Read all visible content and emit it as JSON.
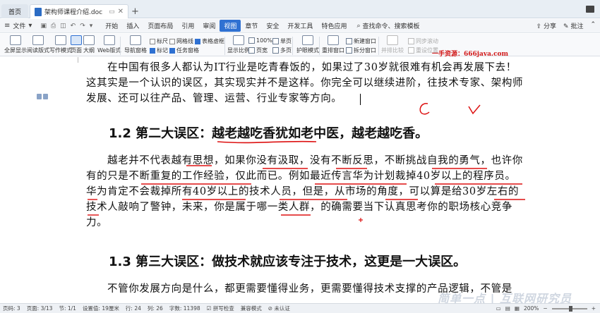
{
  "tabs": {
    "home": "首页",
    "doc": "架构师课程介绍.doc"
  },
  "menubar": {
    "file": "文件",
    "items": [
      "开始",
      "插入",
      "页面布局",
      "引用",
      "审阅",
      "视图",
      "章节",
      "安全",
      "开发工具",
      "特色应用"
    ],
    "active_index": 5,
    "search": "查找命令、搜索模板",
    "share": "分享",
    "comment": "批注"
  },
  "ribbon": {
    "full_screen": "全屏显示",
    "reading": "阅读版式",
    "writing": "写作模式",
    "page": "页面",
    "outline": "大纲",
    "web": "Web版式",
    "nav_pane": "导航窗格",
    "ruler": "标尺",
    "gridlines": "网格线",
    "table_gridlines": "表格虚框",
    "mark": "标记",
    "task_pane": "任务窗格",
    "display_ratio": "显示比例",
    "zoom_100": "100%",
    "single_page": "单页",
    "page_width": "页宽",
    "multi_page": "多页",
    "eye_mode": "护眼模式",
    "rearrange": "重排窗口",
    "new_window": "新建窗口",
    "split_window": "拆分窗口",
    "side_by_side": "并排比较",
    "sync_scroll": "同步滚动",
    "reset_pos": "重设位置"
  },
  "watermark": {
    "source": "一手资源：666java.com",
    "brand": "简单一点 | 互联网研究员"
  },
  "document": {
    "para1": "在中国有很多人都认为IT行业是吃青春饭的，如果过了30岁就很难有机会再发展下去！这其实是一个认识的误区，其实现实并不是这样。你完全可以继续进阶，往技术专家、架构师发展、还可以往产品、管理、运营、行业专家等方向。",
    "h2": "1.2 第二大误区：越老越吃香犹如老中医，越老越吃香。",
    "para2": "越老并不代表越有思想，如果你没有汲取，没有不断反思，不断挑战自我的勇气，也许你有的只是不断重复的工作经验，仅此而已。例如最近传言华为计划裁掉40岁以上的程序员。华为肯定不会裁掉所有40岁以上的技术人员，但是，从市场的角度，可以算是给30岁左右的技术人敲响了警钟，未来，你是属于哪一类人群，的确需要当下认真思考你的职场核心竞争力。",
    "h3": "1.3 第三大误区：做技术就应该专注于技术，这更是一大误区。",
    "para3": "不管你发展方向是什么，都更需要懂得业务，更需要懂得技术支撑的产品逻辑，不管是"
  },
  "statusbar": {
    "page_num": "页码: 3",
    "pages": "页面: 3/13",
    "section": "节: 1/1",
    "setting": "设置值: 19厘米",
    "row": "行: 24",
    "col": "列: 26",
    "words": "字数: 11398",
    "spellcheck": "拼写检查",
    "compat": "兼容模式",
    "cert": "未认证",
    "zoom": "200%"
  }
}
